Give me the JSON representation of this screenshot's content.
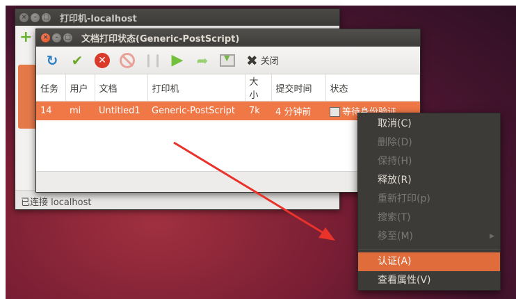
{
  "background_window": {
    "title": "打印机-localhost",
    "status": "已连接 localhost"
  },
  "job_window": {
    "title": "文档打印状态(Generic-PostScript)",
    "toolbar": {
      "close_label": "关闭",
      "icons": [
        "refresh-icon",
        "check-icon",
        "cancel-job-icon",
        "delete-job-icon",
        "hold-icon",
        "release-icon",
        "forward-icon",
        "move-job-icon",
        "close-icon"
      ]
    },
    "table": {
      "headers": [
        "任务",
        "用户",
        "文档",
        "打印机",
        "大小",
        "提交时间",
        "状态"
      ],
      "rows": [
        [
          "14",
          "mi",
          "Untitled1",
          "Generic-PostScript",
          "7k",
          "4 分钟前",
          "等待身份验证"
        ]
      ]
    }
  },
  "context_menu": {
    "items": [
      {
        "label": "取消(C)",
        "state": "enabled"
      },
      {
        "label": "删除(D)",
        "state": "disabled"
      },
      {
        "label": "保持(H)",
        "state": "disabled"
      },
      {
        "label": "释放(R)",
        "state": "enabled"
      },
      {
        "label": "重新打印(p)",
        "state": "disabled"
      },
      {
        "label": "搜索(T)",
        "state": "disabled"
      },
      {
        "label": "移至(M)",
        "state": "disabled"
      },
      {
        "label": "认证(A)",
        "state": "active"
      },
      {
        "label": "查看属性(V)",
        "state": "enabled"
      }
    ]
  },
  "colors": {
    "accent": "#f07746",
    "menu_highlight": "#e06c3b",
    "annotation_arrow": "#e8322a"
  }
}
